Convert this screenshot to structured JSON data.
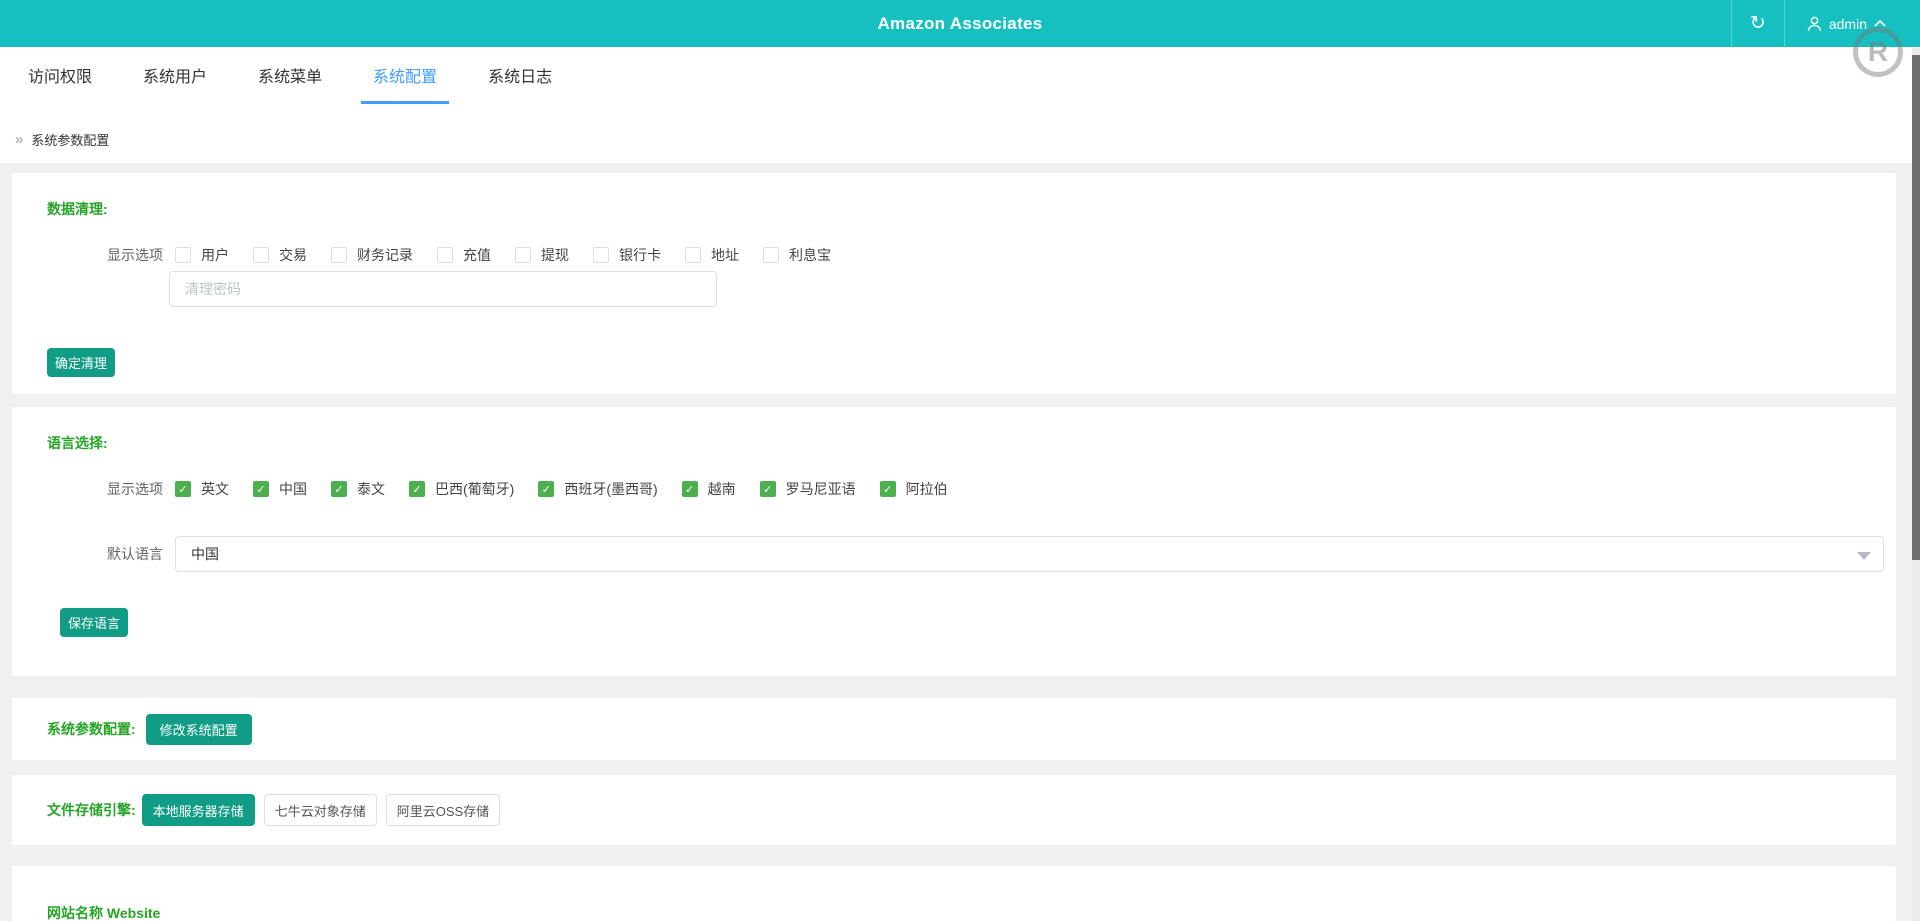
{
  "header": {
    "title": "Amazon Associates",
    "user_name": "admin"
  },
  "icons": {
    "refresh": "↻",
    "breadcrumb_arrow": "»",
    "check": "✓",
    "watermark_letter": "R"
  },
  "tabs": [
    {
      "label": "访问权限",
      "active": false
    },
    {
      "label": "系统用户",
      "active": false
    },
    {
      "label": "系统菜单",
      "active": false
    },
    {
      "label": "系统配置",
      "active": true
    },
    {
      "label": "系统日志",
      "active": false
    }
  ],
  "breadcrumb": {
    "label": "系统参数配置"
  },
  "sections": {
    "data_clean": {
      "title": "数据清理:",
      "options_label": "显示选项",
      "options": [
        {
          "label": "用户",
          "checked": false
        },
        {
          "label": "交易",
          "checked": false
        },
        {
          "label": "财务记录",
          "checked": false
        },
        {
          "label": "充值",
          "checked": false
        },
        {
          "label": "提现",
          "checked": false
        },
        {
          "label": "银行卡",
          "checked": false
        },
        {
          "label": "地址",
          "checked": false
        },
        {
          "label": "利息宝",
          "checked": false
        }
      ],
      "password_placeholder": "清理密码",
      "submit_label": "确定清理"
    },
    "language": {
      "title": "语言选择:",
      "options_label": "显示选项",
      "options": [
        {
          "label": "英文",
          "checked": true
        },
        {
          "label": "中国",
          "checked": true
        },
        {
          "label": "泰文",
          "checked": true
        },
        {
          "label": "巴西(葡萄牙)",
          "checked": true
        },
        {
          "label": "西班牙(墨西哥)",
          "checked": true
        },
        {
          "label": "越南",
          "checked": true
        },
        {
          "label": "罗马尼亚语",
          "checked": true
        },
        {
          "label": "阿拉伯",
          "checked": true
        }
      ],
      "default_label": "默认语言",
      "default_value": "中国",
      "submit_label": "保存语言"
    },
    "system_config": {
      "title": "系统参数配置:",
      "button_label": "修改系统配置"
    },
    "storage": {
      "title": "文件存储引擎:",
      "options": [
        {
          "label": "本地服务器存储",
          "active": true
        },
        {
          "label": "七牛云对象存储",
          "active": false
        },
        {
          "label": "阿里云OSS存储",
          "active": false
        }
      ]
    },
    "website": {
      "title": "网站名称 Website"
    }
  },
  "colors": {
    "header_teal": "#17c0c0",
    "primary_button_teal": "#109c85",
    "active_tab_blue": "#409eff",
    "section_label_green": "#27a427",
    "checkbox_green": "#4cb04f"
  }
}
